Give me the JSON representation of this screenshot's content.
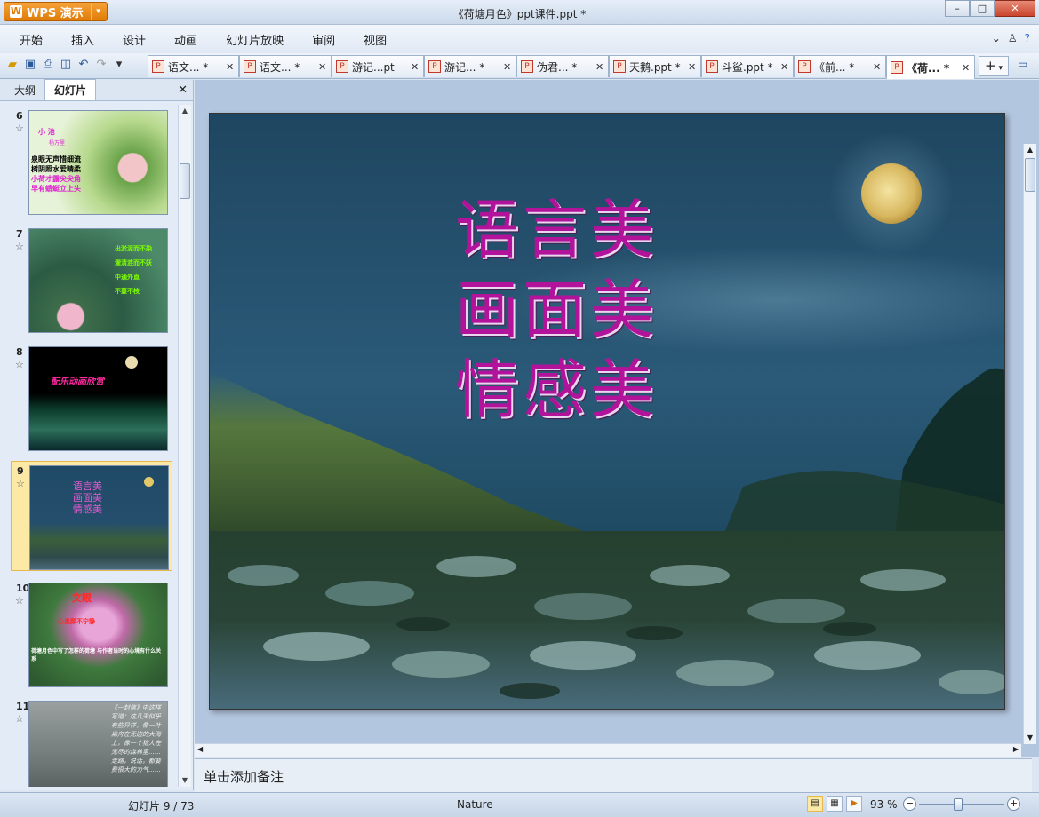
{
  "app": {
    "name": "WPS 演示",
    "window_title": "《荷塘月色》ppt课件.ppt *"
  },
  "menu": [
    "开始",
    "插入",
    "设计",
    "动画",
    "幻灯片放映",
    "审阅",
    "视图"
  ],
  "doc_tabs": [
    {
      "label": "语文... *",
      "active": false
    },
    {
      "label": "语文... *",
      "active": false
    },
    {
      "label": "游记...pt",
      "active": false
    },
    {
      "label": "游记... *",
      "active": false
    },
    {
      "label": "伪君... *",
      "active": false
    },
    {
      "label": "天鹅.ppt *",
      "active": false
    },
    {
      "label": "斗鲨.ppt *",
      "active": false
    },
    {
      "label": "《前... *",
      "active": false
    },
    {
      "label": "《荷... *",
      "active": true
    }
  ],
  "panel": {
    "tab_outline": "大纲",
    "tab_slides": "幻灯片"
  },
  "thumbnails": [
    {
      "num": "6",
      "lines": [
        "小  池",
        "杨万里",
        "泉眼无声惜细流",
        "树阴照水爱晴柔",
        "小荷才露尖尖角",
        "早有蜻蜓立上头"
      ]
    },
    {
      "num": "7",
      "lines": [
        "出淤泥而不染",
        "濯清涟而不妖",
        "中通外直",
        "不蔓不枝"
      ]
    },
    {
      "num": "8",
      "lines": [
        "配乐动画欣赏"
      ]
    },
    {
      "num": "9",
      "lines": [
        "语言美",
        "画面美",
        "情感美"
      ],
      "selected": true
    },
    {
      "num": "10",
      "lines": [
        "文眼",
        "心里颇不宁静",
        "荷塘月色中写了怎样的荷塘 与作者当时的心境有什么关系"
      ]
    },
    {
      "num": "11",
      "lines": [
        "《一封信》中这样写道：这几天似乎有些异样，像一叶扁舟在无边的大海上，像一个猎人在无尽的森林里……走路，说话，都要费很大的力气……"
      ]
    }
  ],
  "slide": {
    "lines": [
      "语言美",
      "画面美",
      "情感美"
    ]
  },
  "notes_placeholder": "单击添加备注",
  "status": {
    "slide_counter": "幻灯片 9 / 73",
    "theme": "Nature",
    "zoom": "93 %"
  },
  "colors": {
    "accent": "#e17b06",
    "slide_text": "#b3139a"
  }
}
